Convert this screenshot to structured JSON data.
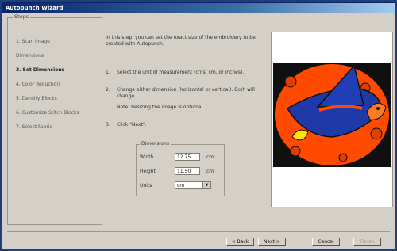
{
  "window": {
    "title": "Autopunch Wizard"
  },
  "steps": {
    "legend": "Steps",
    "items": [
      {
        "label": "1. Scan Image",
        "active": false
      },
      {
        "label": "Dimensions",
        "active": false
      },
      {
        "label": "3. Set Dimensions",
        "active": true
      },
      {
        "label": "4. Color Reduction",
        "active": false
      },
      {
        "label": "5. Density Blocks",
        "active": false
      },
      {
        "label": "6. Customize Stitch Blocks",
        "active": false
      },
      {
        "label": "7. Select Fabric",
        "active": false
      }
    ]
  },
  "content": {
    "intro": "In this step, you can set the exact size of the embroidery to be created with Autopunch.",
    "instructions": [
      {
        "num": "1.",
        "text": "Select the unit of measurement (cms, cm, or inches)."
      },
      {
        "num": "2.",
        "text": "Change either dimension (horizontal or vertical). Both will change."
      },
      {
        "num": "",
        "text": "Note: Resizing the image is optional."
      },
      {
        "num": "3.",
        "text": "Click \"Next\"."
      }
    ]
  },
  "dimensions": {
    "legend": "Dimensions",
    "width_label": "Width",
    "width_value": "12.75",
    "width_unit": "cm",
    "height_label": "Height",
    "height_value": "11.50",
    "height_unit": "cm",
    "units_label": "Units",
    "units_value": "cm"
  },
  "buttons": {
    "back": "< Back",
    "next": "Next >",
    "cancel": "Cancel",
    "finish": "Finish"
  },
  "colors": {
    "preview_bg": "#ff4a00",
    "hat": "#1d3aa8",
    "dark": "#101010"
  }
}
